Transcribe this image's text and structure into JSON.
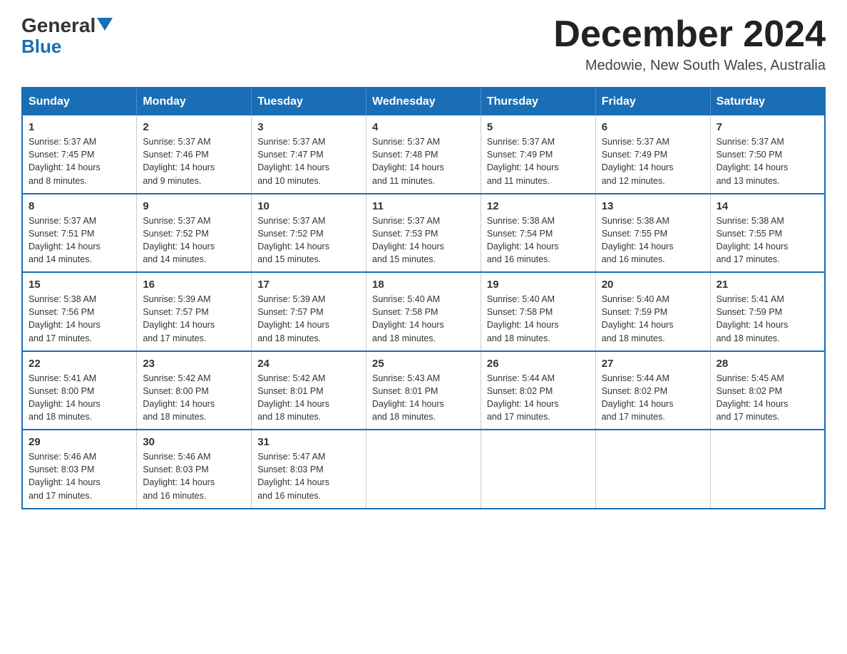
{
  "header": {
    "logo_general": "General",
    "logo_blue": "Blue",
    "month_title": "December 2024",
    "location": "Medowie, New South Wales, Australia"
  },
  "days_of_week": [
    "Sunday",
    "Monday",
    "Tuesday",
    "Wednesday",
    "Thursday",
    "Friday",
    "Saturday"
  ],
  "weeks": [
    [
      {
        "num": "1",
        "sunrise": "5:37 AM",
        "sunset": "7:45 PM",
        "daylight": "14 hours and 8 minutes."
      },
      {
        "num": "2",
        "sunrise": "5:37 AM",
        "sunset": "7:46 PM",
        "daylight": "14 hours and 9 minutes."
      },
      {
        "num": "3",
        "sunrise": "5:37 AM",
        "sunset": "7:47 PM",
        "daylight": "14 hours and 10 minutes."
      },
      {
        "num": "4",
        "sunrise": "5:37 AM",
        "sunset": "7:48 PM",
        "daylight": "14 hours and 11 minutes."
      },
      {
        "num": "5",
        "sunrise": "5:37 AM",
        "sunset": "7:49 PM",
        "daylight": "14 hours and 11 minutes."
      },
      {
        "num": "6",
        "sunrise": "5:37 AM",
        "sunset": "7:49 PM",
        "daylight": "14 hours and 12 minutes."
      },
      {
        "num": "7",
        "sunrise": "5:37 AM",
        "sunset": "7:50 PM",
        "daylight": "14 hours and 13 minutes."
      }
    ],
    [
      {
        "num": "8",
        "sunrise": "5:37 AM",
        "sunset": "7:51 PM",
        "daylight": "14 hours and 14 minutes."
      },
      {
        "num": "9",
        "sunrise": "5:37 AM",
        "sunset": "7:52 PM",
        "daylight": "14 hours and 14 minutes."
      },
      {
        "num": "10",
        "sunrise": "5:37 AM",
        "sunset": "7:52 PM",
        "daylight": "14 hours and 15 minutes."
      },
      {
        "num": "11",
        "sunrise": "5:37 AM",
        "sunset": "7:53 PM",
        "daylight": "14 hours and 15 minutes."
      },
      {
        "num": "12",
        "sunrise": "5:38 AM",
        "sunset": "7:54 PM",
        "daylight": "14 hours and 16 minutes."
      },
      {
        "num": "13",
        "sunrise": "5:38 AM",
        "sunset": "7:55 PM",
        "daylight": "14 hours and 16 minutes."
      },
      {
        "num": "14",
        "sunrise": "5:38 AM",
        "sunset": "7:55 PM",
        "daylight": "14 hours and 17 minutes."
      }
    ],
    [
      {
        "num": "15",
        "sunrise": "5:38 AM",
        "sunset": "7:56 PM",
        "daylight": "14 hours and 17 minutes."
      },
      {
        "num": "16",
        "sunrise": "5:39 AM",
        "sunset": "7:57 PM",
        "daylight": "14 hours and 17 minutes."
      },
      {
        "num": "17",
        "sunrise": "5:39 AM",
        "sunset": "7:57 PM",
        "daylight": "14 hours and 18 minutes."
      },
      {
        "num": "18",
        "sunrise": "5:40 AM",
        "sunset": "7:58 PM",
        "daylight": "14 hours and 18 minutes."
      },
      {
        "num": "19",
        "sunrise": "5:40 AM",
        "sunset": "7:58 PM",
        "daylight": "14 hours and 18 minutes."
      },
      {
        "num": "20",
        "sunrise": "5:40 AM",
        "sunset": "7:59 PM",
        "daylight": "14 hours and 18 minutes."
      },
      {
        "num": "21",
        "sunrise": "5:41 AM",
        "sunset": "7:59 PM",
        "daylight": "14 hours and 18 minutes."
      }
    ],
    [
      {
        "num": "22",
        "sunrise": "5:41 AM",
        "sunset": "8:00 PM",
        "daylight": "14 hours and 18 minutes."
      },
      {
        "num": "23",
        "sunrise": "5:42 AM",
        "sunset": "8:00 PM",
        "daylight": "14 hours and 18 minutes."
      },
      {
        "num": "24",
        "sunrise": "5:42 AM",
        "sunset": "8:01 PM",
        "daylight": "14 hours and 18 minutes."
      },
      {
        "num": "25",
        "sunrise": "5:43 AM",
        "sunset": "8:01 PM",
        "daylight": "14 hours and 18 minutes."
      },
      {
        "num": "26",
        "sunrise": "5:44 AM",
        "sunset": "8:02 PM",
        "daylight": "14 hours and 17 minutes."
      },
      {
        "num": "27",
        "sunrise": "5:44 AM",
        "sunset": "8:02 PM",
        "daylight": "14 hours and 17 minutes."
      },
      {
        "num": "28",
        "sunrise": "5:45 AM",
        "sunset": "8:02 PM",
        "daylight": "14 hours and 17 minutes."
      }
    ],
    [
      {
        "num": "29",
        "sunrise": "5:46 AM",
        "sunset": "8:03 PM",
        "daylight": "14 hours and 17 minutes."
      },
      {
        "num": "30",
        "sunrise": "5:46 AM",
        "sunset": "8:03 PM",
        "daylight": "14 hours and 16 minutes."
      },
      {
        "num": "31",
        "sunrise": "5:47 AM",
        "sunset": "8:03 PM",
        "daylight": "14 hours and 16 minutes."
      },
      null,
      null,
      null,
      null
    ]
  ],
  "labels": {
    "sunrise": "Sunrise:",
    "sunset": "Sunset:",
    "daylight": "Daylight:"
  }
}
